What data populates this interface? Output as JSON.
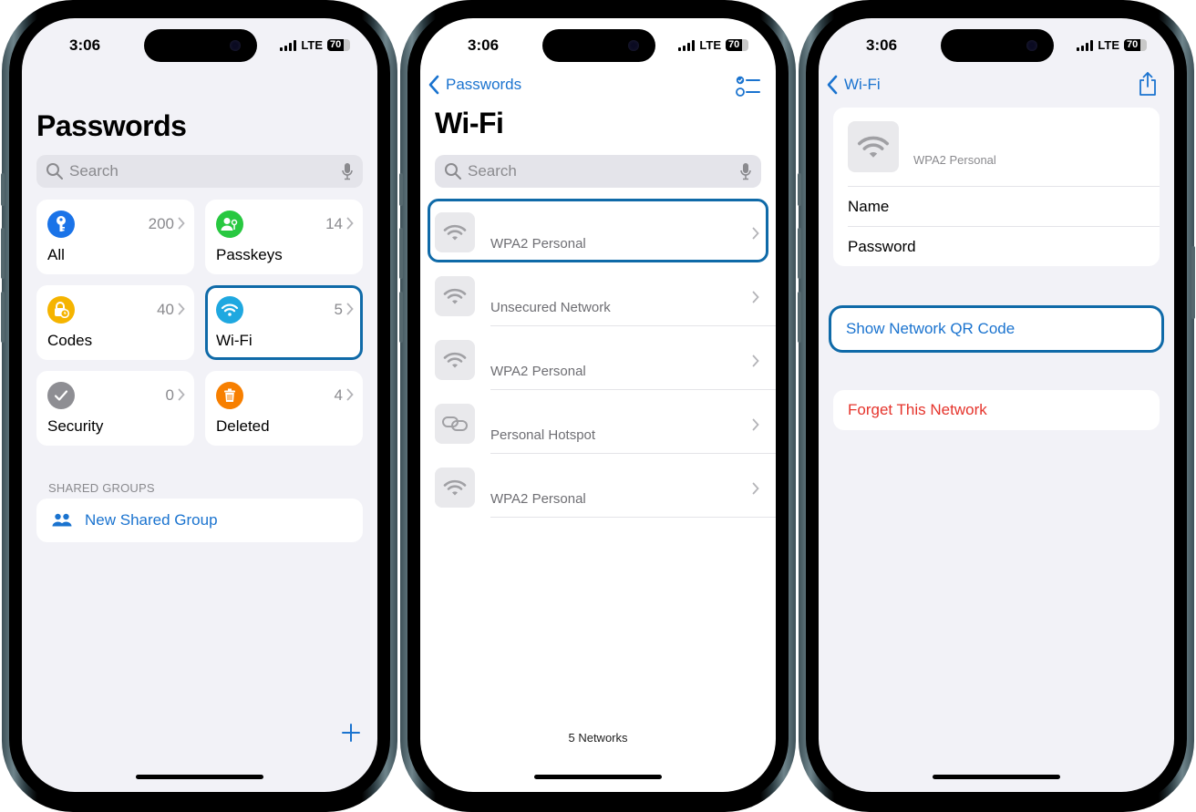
{
  "status_bar": {
    "time": "3:06",
    "network": "LTE",
    "battery": "70",
    "battery_level_percent": 70,
    "signal_bars": 4
  },
  "colors": {
    "accent": "#1a73cf",
    "highlight_outline": "#0f6aa8",
    "destructive": "#e5342c",
    "secondary_text": "#8a8a8e"
  },
  "phone1": {
    "title": "Passwords",
    "search": {
      "placeholder": "Search"
    },
    "tiles": [
      {
        "label": "All",
        "count": "200",
        "icon": "key-icon",
        "color": "#1a73e8"
      },
      {
        "label": "Passkeys",
        "count": "14",
        "icon": "passkey-person-icon",
        "color": "#28c840"
      },
      {
        "label": "Codes",
        "count": "40",
        "icon": "lock-clock-icon",
        "color": "#f5b400"
      },
      {
        "label": "Wi-Fi",
        "count": "5",
        "icon": "wifi-icon",
        "color": "#1fa8e0",
        "highlighted": true
      },
      {
        "label": "Security",
        "count": "0",
        "icon": "checkmark-icon",
        "color": "#8e8e93"
      },
      {
        "label": "Deleted",
        "count": "4",
        "icon": "trash-icon",
        "color": "#f77f00"
      }
    ],
    "shared_groups_header": "SHARED GROUPS",
    "new_shared_group": "New Shared Group",
    "add_icon": "plus-icon"
  },
  "phone2": {
    "back_label": "Passwords",
    "title": "Wi-Fi",
    "search": {
      "placeholder": "Search"
    },
    "networks": [
      {
        "name": "",
        "security": "WPA2 Personal",
        "icon": "wifi-icon",
        "highlighted": true
      },
      {
        "name": "",
        "security": "Unsecured Network",
        "icon": "wifi-icon"
      },
      {
        "name": "",
        "security": "WPA2 Personal",
        "icon": "wifi-icon"
      },
      {
        "name": "",
        "security": "Personal Hotspot",
        "icon": "link-icon"
      },
      {
        "name": "",
        "security": "WPA2 Personal",
        "icon": "wifi-icon"
      }
    ],
    "footer": "5 Networks"
  },
  "phone3": {
    "back_label": "Wi-Fi",
    "security": "WPA2 Personal",
    "fields": [
      {
        "label": "Name"
      },
      {
        "label": "Password"
      }
    ],
    "show_qr": "Show Network QR Code",
    "forget": "Forget This Network"
  }
}
